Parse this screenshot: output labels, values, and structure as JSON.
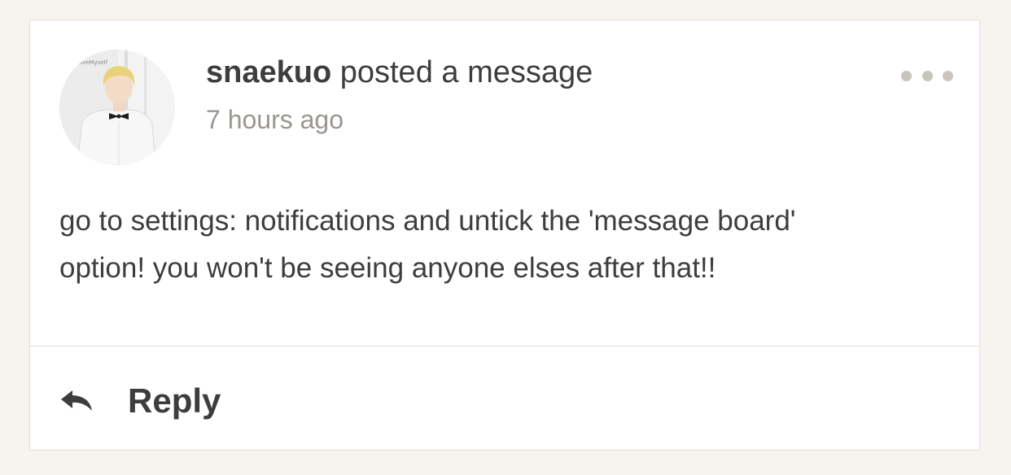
{
  "post": {
    "username": "snaekuo",
    "action_text": " posted a message",
    "timestamp": "7 hours ago",
    "avatar_caption": "LoveMyself",
    "message_line1": "go to settings: notifications and untick the 'message board'",
    "message_line2": "option! you won't be seeing anyone elses after that!!"
  },
  "actions": {
    "more_icon": "more-horizontal-icon",
    "reply_icon": "reply-arrow-icon",
    "reply_label": "Reply"
  },
  "colors": {
    "background": "#f6f4ef",
    "card": "#ffffff",
    "text": "#3d3d3d",
    "muted": "#9a9690",
    "dots": "#c8c4be"
  }
}
